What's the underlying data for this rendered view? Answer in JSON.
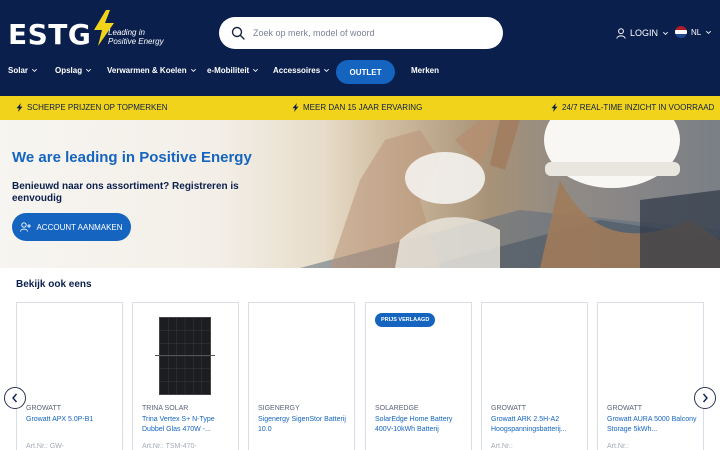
{
  "header": {
    "logo_text": "ESTG",
    "logo_tagline": "Leading in\nPositive Energy",
    "search_placeholder": "Zoek op merk, model of woord",
    "login_label": "LOGIN",
    "lang_label": "NL"
  },
  "nav": {
    "items": [
      {
        "label": "Solar"
      },
      {
        "label": "Opslag"
      },
      {
        "label": "Verwarmen & Koelen"
      },
      {
        "label": "e-Mobiliteit"
      },
      {
        "label": "Accessoires"
      }
    ],
    "outlet_label": "OUTLET",
    "merken_label": "Merken"
  },
  "usp": [
    {
      "label": "SCHERPE PRIJZEN OP TOPMERKEN"
    },
    {
      "label": "MEER DAN 15 JAAR ERVARING"
    },
    {
      "label": "24/7 REAL-TIME INZICHT IN VOORRAAD"
    }
  ],
  "hero": {
    "title": "We are leading in Positive Energy",
    "subtitle": "Benieuwd naar ons assortiment? Registreren is eenvoudig",
    "button_label": "ACCOUNT AANMAKEN"
  },
  "products": {
    "title": "Bekijk ook eens",
    "items": [
      {
        "brand": "GROWATT",
        "name": "Growatt APX 5.0P-B1",
        "art": "Art.Nr.: GW-",
        "badge": "",
        "image": "none"
      },
      {
        "brand": "TRINA SOLAR",
        "name": "Trina Vertex S+ N-Type Dubbel Glas 470W -...",
        "art": "Art.Nr.: TSM-470-",
        "badge": "",
        "image": "solar-panel"
      },
      {
        "brand": "SIGENERGY",
        "name": "Sigenergy SigenStor Batterij 10.0",
        "art": "",
        "badge": "",
        "image": "none"
      },
      {
        "brand": "SOLAREDGE",
        "name": "SolarEdge Home Battery 400V-10kWh Batterij",
        "art": "",
        "badge": "PRIJS VERLAAGD",
        "image": "none"
      },
      {
        "brand": "GROWATT",
        "name": "Growatt ARK 2.5H-A2 Hoogspanningsbatterij...",
        "art": "Art.Nr.:",
        "badge": "",
        "image": "none"
      },
      {
        "brand": "GROWATT",
        "name": "Growatt AURA 5000 Balcony Storage 5kWh...",
        "art": "Art.Nr.:",
        "badge": "",
        "image": "none"
      }
    ]
  },
  "colors": {
    "navy": "#0b1f4d",
    "accent_blue": "#1565c0",
    "yellow": "#f2d31b"
  },
  "icons": {
    "search": "search-icon",
    "user": "user-icon",
    "flag": "netherlands-flag-icon",
    "usp": "bolt-icon",
    "prev": "chevron-left-icon",
    "next": "chevron-right-icon"
  }
}
